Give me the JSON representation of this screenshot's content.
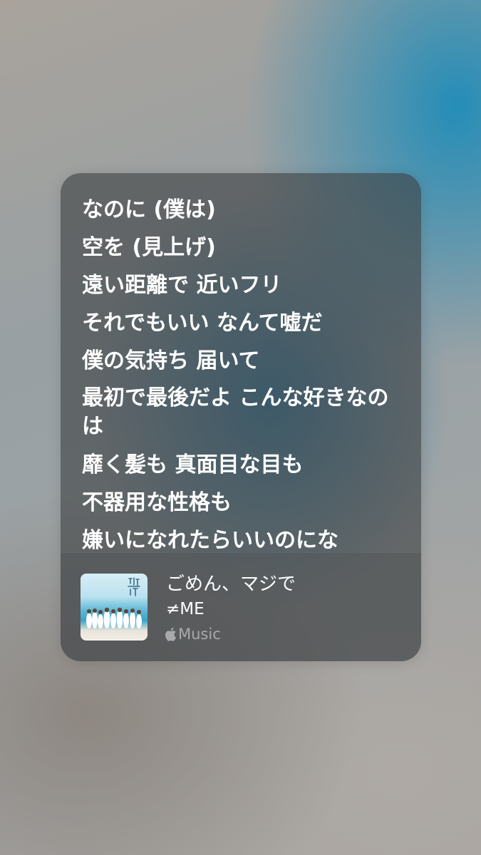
{
  "lyrics": [
    "なのに (僕は)",
    "空を (見上げ)",
    "遠い距離で 近いフリ",
    "それでもいい なんて嘘だ",
    "僕の気持ち 届いて",
    "最初で最後だよ こんな好きなのは",
    "靡く髪も 真面目な目も",
    "不器用な性格も",
    "嫌いになれたらいいのにな"
  ],
  "track": {
    "title": "ごめん、マジで",
    "artist": "≠ME",
    "service": "Music",
    "service_icon": "apple-logo-icon",
    "artwork_icon": "album-artwork"
  },
  "colors": {
    "card": "#3e4042",
    "text": "#ffffff",
    "secondary_text": "#9a9c9e",
    "accent_blue": "#1e8cb9"
  }
}
